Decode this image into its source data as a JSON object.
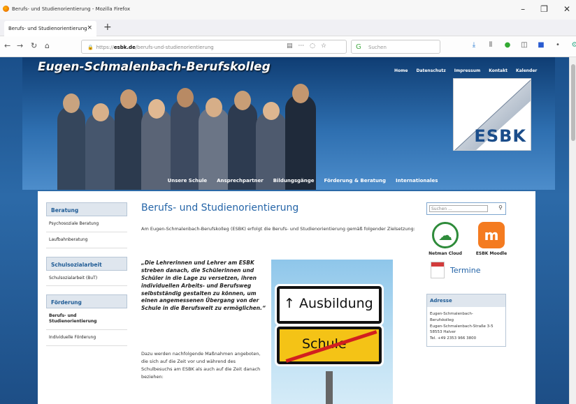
{
  "window": {
    "title": "Berufs- und Studienorientierung - Mozilla Firefox"
  },
  "tab": {
    "label": "Berufs- und Studienorientierung",
    "new_tab": "+"
  },
  "url": {
    "prefix": "https://",
    "domain": "esbk.de",
    "path": "/berufs-und-studienorientierung"
  },
  "search": {
    "placeholder": "Suchen"
  },
  "site": {
    "title": "Eugen-Schmalenbach-Berufskolleg",
    "toplinks": [
      "Home",
      "Datenschutz",
      "Impressum",
      "Kontakt",
      "Kalender"
    ],
    "logo": "ESBK",
    "mainnav": [
      "Unsere Schule",
      "Ansprechpartner",
      "Bildungsgänge",
      "Förderung & Beratung",
      "Internationales"
    ]
  },
  "sidebar": {
    "sections": [
      {
        "title": "Beratung",
        "items": [
          "Psychosoziale Beratung",
          "Laufbahnberatung"
        ]
      },
      {
        "title": "Schulsozialarbeit",
        "items": [
          "Schulsozialarbeit (BuT)"
        ]
      },
      {
        "title": "Förderung",
        "items": [
          "Berufs- und Studienorientierung",
          "Individuelle Förderung"
        ]
      }
    ]
  },
  "main": {
    "heading": "Berufs- und Studienorientierung",
    "intro": "Am Eugen-Schmalenbach-Berufskolleg (ESBK) erfolgt die Berufs- und Studienorientierung gemäß folgender Zielsetzung:",
    "quote": "„Die Lehrerinnen und Lehrer am ESBK streben danach, die Schülerinnen und Schüler in die Lage zu versetzen, ihren individuellen Arbeits- und Berufsweg selbstständig gestalten zu können, um einen angemessenen Übergang von der Schule in die Berufswelt zu ermöglichen.“",
    "body": "Dazu werden nachfolgende Maßnahmen angeboten, die sich auf die Zeit vor und während des Schulbesuchs am ESBK als auch auf die Zeit danach beziehen:",
    "sign_top": "↑ Ausbildung",
    "sign_bottom": "Schule"
  },
  "right": {
    "search_placeholder": "Suchen ...",
    "apps": [
      {
        "label": "Netman Cloud"
      },
      {
        "label": "ESBK Moodle",
        "glyph": "m"
      }
    ],
    "termine": "Termine",
    "address": {
      "title": "Adresse",
      "lines": [
        "Eugen-Schmalenbach-",
        "Berufskolleg",
        "Eugen-Schmalenbach-Straße 3-5",
        "58553 Halver",
        "",
        "Tel. +49 2353 966 3800"
      ]
    }
  },
  "colors": {
    "brand_blue": "#2565a8",
    "header_dark": "#0f3d73",
    "moodle_orange": "#f47b20",
    "cloud_green": "#2e8b3a"
  }
}
